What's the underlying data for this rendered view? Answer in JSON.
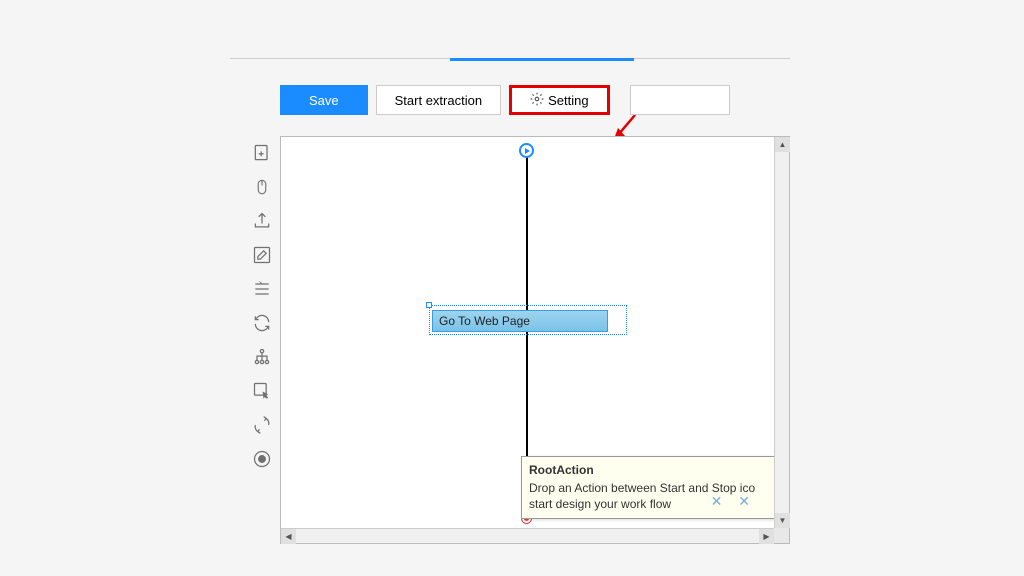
{
  "toolbar": {
    "save_label": "Save",
    "start_extraction_label": "Start extraction",
    "setting_label": "Setting"
  },
  "side_toolbar": {
    "icons": [
      "add-page-icon",
      "mouse-icon",
      "upload-icon",
      "edit-icon",
      "list-icon",
      "refresh-icon",
      "tree-icon",
      "cursor-box-icon",
      "cycle-icon",
      "stop-circle-icon"
    ]
  },
  "workflow": {
    "action_node_label": "Go To Web Page"
  },
  "tooltip": {
    "title": "RootAction",
    "line1": "Drop an Action between Start and Stop ico",
    "line2": "start design your work flow"
  }
}
